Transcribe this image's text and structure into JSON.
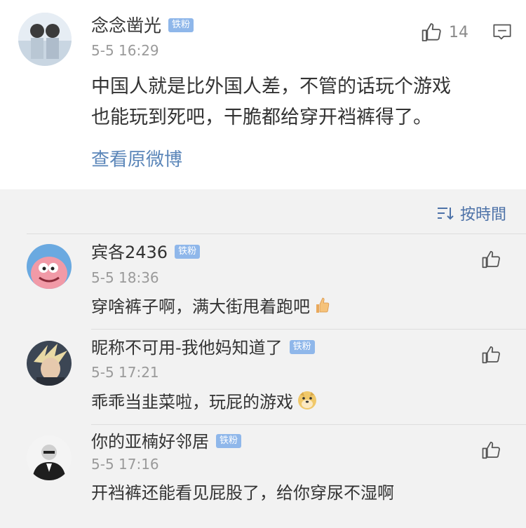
{
  "main_post": {
    "username": "念念凿光",
    "badge": "铁粉",
    "time": "5-5 16:29",
    "like_count": "14",
    "text_line1": "中国人就是比外国人差，不管的话玩个游戏",
    "text_line2": "也能玩到死吧，干脆都给穿开裆裤得了。",
    "view_original": "查看原微博"
  },
  "sort_label": "按時間",
  "replies": [
    {
      "username": "宾各2436",
      "badge": "铁粉",
      "time": "5-5 18:36",
      "text": "穿啥裤子啊，满大街甩着跑吧"
    },
    {
      "username": "昵称不可用-我他妈知道了",
      "badge": "铁粉",
      "time": "5-5 17:21",
      "text": "乖乖当韭菜啦，玩屁的游戏"
    },
    {
      "username": "你的亚楠好邻居",
      "badge": "铁粉",
      "time": "5-5 17:16",
      "text": "开裆裤还能看见屁股了，给你穿尿不湿啊"
    }
  ],
  "colors": {
    "badge": "#8fb7ea",
    "link": "#5b86b9",
    "sort": "#4d72a8",
    "time": "#9a9a9a"
  },
  "icons": [
    "thumbs-up-icon",
    "comment-icon",
    "sort-icon",
    "thumbs-up-emoji-icon",
    "doge-emoji-icon"
  ]
}
